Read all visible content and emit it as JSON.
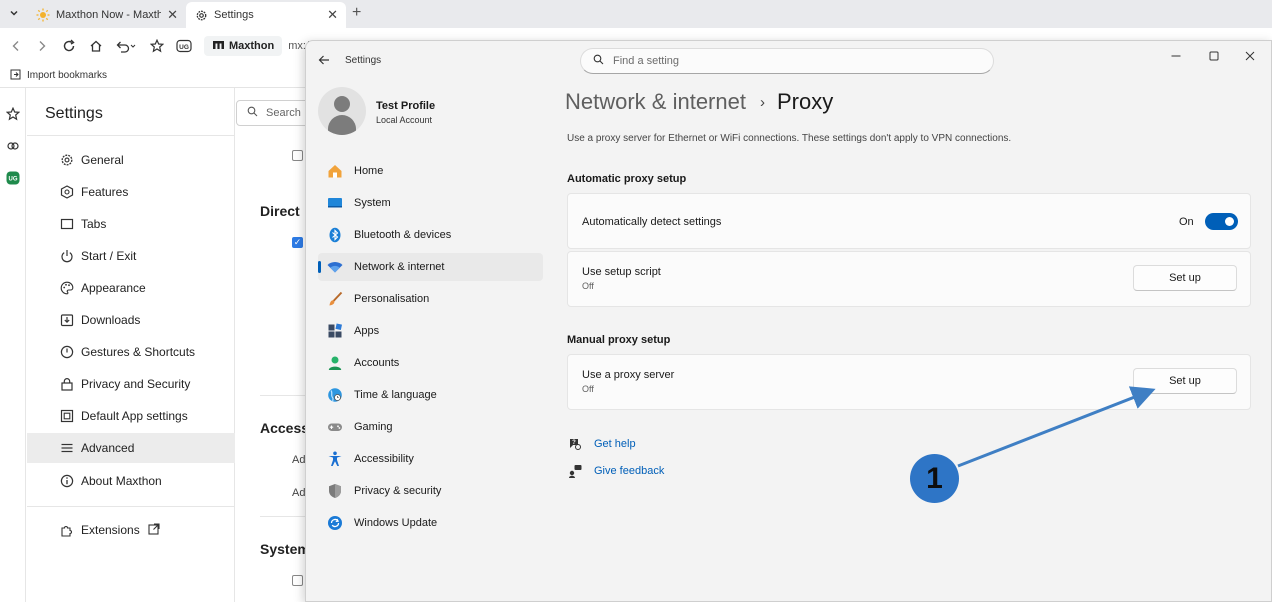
{
  "browser": {
    "tabs": [
      {
        "label": "Maxthon Now - Maxtho",
        "icon": "sun-icon"
      },
      {
        "label": "Settings",
        "icon": "gear-icon"
      }
    ],
    "new_tab": "+",
    "address_brand": "Maxthon",
    "address_url": "mx://",
    "bookmark_import": "Import bookmarks",
    "ug_badge": "UG"
  },
  "maxthon": {
    "title": "Settings",
    "search_placeholder": "Search",
    "items": [
      {
        "label": "General",
        "icon": "gear-icon"
      },
      {
        "label": "Features",
        "icon": "features-icon"
      },
      {
        "label": "Tabs",
        "icon": "tabs-icon"
      },
      {
        "label": "Start / Exit",
        "icon": "power-icon"
      },
      {
        "label": "Appearance",
        "icon": "palette-icon"
      },
      {
        "label": "Downloads",
        "icon": "download-icon"
      },
      {
        "label": "Gestures & Shortcuts",
        "icon": "gesture-icon"
      },
      {
        "label": "Privacy and Security",
        "icon": "lock-icon"
      },
      {
        "label": "Default App settings",
        "icon": "default-app-icon"
      },
      {
        "label": "Advanced",
        "icon": "advanced-icon"
      },
      {
        "label": "About Maxthon",
        "icon": "info-icon"
      },
      {
        "label": "Extensions",
        "icon": "extensions-icon"
      }
    ],
    "content": {
      "direct_heading": "Direct",
      "access_heading": "Access",
      "ad1": "Ad",
      "ad2": "Ad",
      "system_heading": "System"
    }
  },
  "windows": {
    "app_title": "Settings",
    "search_placeholder": "Find a setting",
    "profile": {
      "name": "Test Profile",
      "type": "Local Account"
    },
    "nav": [
      {
        "label": "Home",
        "icon": "home-icon",
        "color": "#e8912b"
      },
      {
        "label": "System",
        "icon": "system-icon",
        "color": "#0f7ad8"
      },
      {
        "label": "Bluetooth & devices",
        "icon": "bluetooth-icon",
        "color": "#0f7ad8"
      },
      {
        "label": "Network & internet",
        "icon": "wifi-icon",
        "color": "#2c6fd1"
      },
      {
        "label": "Personalisation",
        "icon": "brush-icon",
        "color": "#d9813a"
      },
      {
        "label": "Apps",
        "icon": "apps-icon",
        "color": "#3a4a63"
      },
      {
        "label": "Accounts",
        "icon": "accounts-icon",
        "color": "#1fa35c"
      },
      {
        "label": "Time & language",
        "icon": "globe-icon",
        "color": "#1a8ad6"
      },
      {
        "label": "Gaming",
        "icon": "gaming-icon",
        "color": "#7a7a7a"
      },
      {
        "label": "Accessibility",
        "icon": "accessibility-icon",
        "color": "#1a6fd1"
      },
      {
        "label": "Privacy & security",
        "icon": "shield-icon",
        "color": "#6b6b6b"
      },
      {
        "label": "Windows Update",
        "icon": "update-icon",
        "color": "#1a7ad6"
      }
    ],
    "breadcrumb": {
      "parent": "Network & internet",
      "sep": "›",
      "current": "Proxy"
    },
    "description": "Use a proxy server for Ethernet or WiFi connections. These settings don't apply to VPN connections.",
    "auto_section": "Automatic proxy setup",
    "auto_detect": {
      "label": "Automatically detect settings",
      "state": "On"
    },
    "setup_script": {
      "label": "Use setup script",
      "sub": "Off",
      "button": "Set up"
    },
    "manual_section": "Manual proxy setup",
    "proxy_server": {
      "label": "Use a proxy server",
      "sub": "Off",
      "button": "Set up"
    },
    "get_help": "Get help",
    "give_feedback": "Give feedback"
  },
  "annotation": {
    "number": "1",
    "color": "#2e75c6"
  }
}
